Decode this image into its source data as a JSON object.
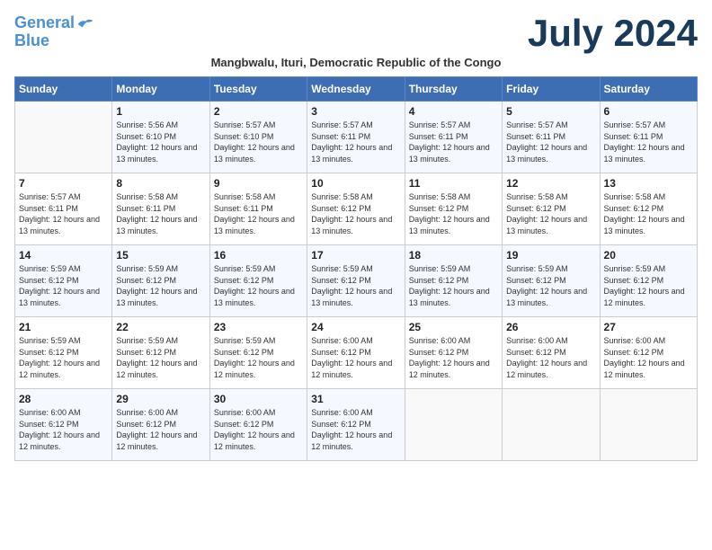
{
  "header": {
    "logo_line1": "General",
    "logo_line2": "Blue",
    "month_title": "July 2024",
    "subtitle": "Mangbwalu, Ituri, Democratic Republic of the Congo"
  },
  "weekdays": [
    "Sunday",
    "Monday",
    "Tuesday",
    "Wednesday",
    "Thursday",
    "Friday",
    "Saturday"
  ],
  "weeks": [
    [
      {
        "day": "",
        "sunrise": "",
        "sunset": "",
        "daylight": ""
      },
      {
        "day": "1",
        "sunrise": "5:56 AM",
        "sunset": "6:10 PM",
        "daylight": "12 hours and 13 minutes."
      },
      {
        "day": "2",
        "sunrise": "5:57 AM",
        "sunset": "6:10 PM",
        "daylight": "12 hours and 13 minutes."
      },
      {
        "day": "3",
        "sunrise": "5:57 AM",
        "sunset": "6:11 PM",
        "daylight": "12 hours and 13 minutes."
      },
      {
        "day": "4",
        "sunrise": "5:57 AM",
        "sunset": "6:11 PM",
        "daylight": "12 hours and 13 minutes."
      },
      {
        "day": "5",
        "sunrise": "5:57 AM",
        "sunset": "6:11 PM",
        "daylight": "12 hours and 13 minutes."
      },
      {
        "day": "6",
        "sunrise": "5:57 AM",
        "sunset": "6:11 PM",
        "daylight": "12 hours and 13 minutes."
      }
    ],
    [
      {
        "day": "7",
        "sunrise": "5:57 AM",
        "sunset": "6:11 PM",
        "daylight": "12 hours and 13 minutes."
      },
      {
        "day": "8",
        "sunrise": "5:58 AM",
        "sunset": "6:11 PM",
        "daylight": "12 hours and 13 minutes."
      },
      {
        "day": "9",
        "sunrise": "5:58 AM",
        "sunset": "6:11 PM",
        "daylight": "12 hours and 13 minutes."
      },
      {
        "day": "10",
        "sunrise": "5:58 AM",
        "sunset": "6:12 PM",
        "daylight": "12 hours and 13 minutes."
      },
      {
        "day": "11",
        "sunrise": "5:58 AM",
        "sunset": "6:12 PM",
        "daylight": "12 hours and 13 minutes."
      },
      {
        "day": "12",
        "sunrise": "5:58 AM",
        "sunset": "6:12 PM",
        "daylight": "12 hours and 13 minutes."
      },
      {
        "day": "13",
        "sunrise": "5:58 AM",
        "sunset": "6:12 PM",
        "daylight": "12 hours and 13 minutes."
      }
    ],
    [
      {
        "day": "14",
        "sunrise": "5:59 AM",
        "sunset": "6:12 PM",
        "daylight": "12 hours and 13 minutes."
      },
      {
        "day": "15",
        "sunrise": "5:59 AM",
        "sunset": "6:12 PM",
        "daylight": "12 hours and 13 minutes."
      },
      {
        "day": "16",
        "sunrise": "5:59 AM",
        "sunset": "6:12 PM",
        "daylight": "12 hours and 13 minutes."
      },
      {
        "day": "17",
        "sunrise": "5:59 AM",
        "sunset": "6:12 PM",
        "daylight": "12 hours and 13 minutes."
      },
      {
        "day": "18",
        "sunrise": "5:59 AM",
        "sunset": "6:12 PM",
        "daylight": "12 hours and 13 minutes."
      },
      {
        "day": "19",
        "sunrise": "5:59 AM",
        "sunset": "6:12 PM",
        "daylight": "12 hours and 13 minutes."
      },
      {
        "day": "20",
        "sunrise": "5:59 AM",
        "sunset": "6:12 PM",
        "daylight": "12 hours and 12 minutes."
      }
    ],
    [
      {
        "day": "21",
        "sunrise": "5:59 AM",
        "sunset": "6:12 PM",
        "daylight": "12 hours and 12 minutes."
      },
      {
        "day": "22",
        "sunrise": "5:59 AM",
        "sunset": "6:12 PM",
        "daylight": "12 hours and 12 minutes."
      },
      {
        "day": "23",
        "sunrise": "5:59 AM",
        "sunset": "6:12 PM",
        "daylight": "12 hours and 12 minutes."
      },
      {
        "day": "24",
        "sunrise": "6:00 AM",
        "sunset": "6:12 PM",
        "daylight": "12 hours and 12 minutes."
      },
      {
        "day": "25",
        "sunrise": "6:00 AM",
        "sunset": "6:12 PM",
        "daylight": "12 hours and 12 minutes."
      },
      {
        "day": "26",
        "sunrise": "6:00 AM",
        "sunset": "6:12 PM",
        "daylight": "12 hours and 12 minutes."
      },
      {
        "day": "27",
        "sunrise": "6:00 AM",
        "sunset": "6:12 PM",
        "daylight": "12 hours and 12 minutes."
      }
    ],
    [
      {
        "day": "28",
        "sunrise": "6:00 AM",
        "sunset": "6:12 PM",
        "daylight": "12 hours and 12 minutes."
      },
      {
        "day": "29",
        "sunrise": "6:00 AM",
        "sunset": "6:12 PM",
        "daylight": "12 hours and 12 minutes."
      },
      {
        "day": "30",
        "sunrise": "6:00 AM",
        "sunset": "6:12 PM",
        "daylight": "12 hours and 12 minutes."
      },
      {
        "day": "31",
        "sunrise": "6:00 AM",
        "sunset": "6:12 PM",
        "daylight": "12 hours and 12 minutes."
      },
      {
        "day": "",
        "sunrise": "",
        "sunset": "",
        "daylight": ""
      },
      {
        "day": "",
        "sunrise": "",
        "sunset": "",
        "daylight": ""
      },
      {
        "day": "",
        "sunrise": "",
        "sunset": "",
        "daylight": ""
      }
    ]
  ]
}
